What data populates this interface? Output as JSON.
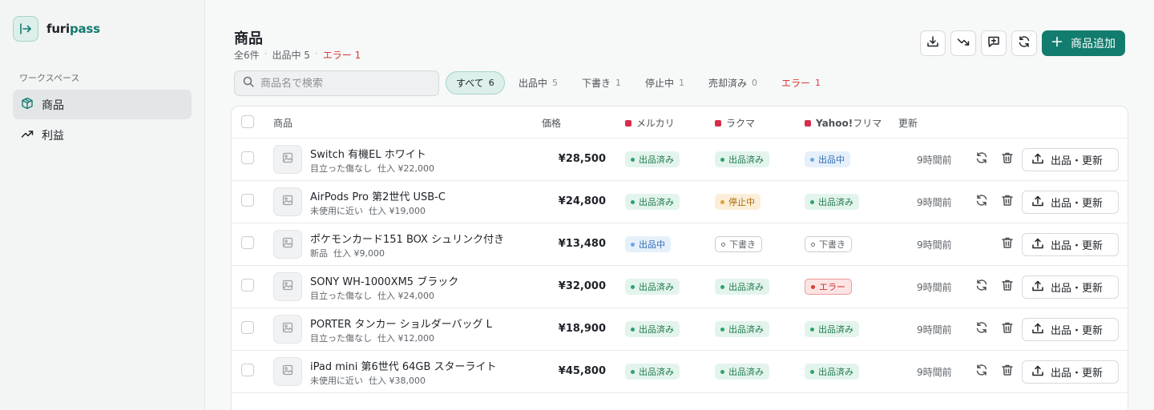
{
  "app": {
    "logo_part1": "furi",
    "logo_part2": "pass",
    "logo_icon": "arrow-into-box-icon",
    "accent_color": "#127c6e"
  },
  "sidebar": {
    "section_label": "ワークスペース",
    "items": [
      {
        "label": "商品",
        "icon": "package-icon",
        "active": true
      },
      {
        "label": "利益",
        "icon": "trending-up-icon",
        "active": false
      }
    ]
  },
  "header": {
    "title": "商品",
    "total": "全6件",
    "listing": "出品中 5",
    "error": "エラー 1",
    "separator": "·",
    "toolbar_icons": [
      "download-icon",
      "trending-down-icon",
      "message-plus-icon",
      "refresh-icon"
    ],
    "add_button_label": "商品追加"
  },
  "search": {
    "placeholder": "商品名で検索",
    "value": ""
  },
  "filters": [
    {
      "label": "すべて",
      "count": "6",
      "active": true
    },
    {
      "label": "出品中",
      "count": "5",
      "active": false
    },
    {
      "label": "下書き",
      "count": "1",
      "active": false
    },
    {
      "label": "停止中",
      "count": "1",
      "active": false
    },
    {
      "label": "売却済み",
      "count": "0",
      "active": false
    },
    {
      "label": "エラー",
      "count": "1",
      "active": false
    }
  ],
  "table": {
    "columns": {
      "product": "商品",
      "price": "価格",
      "mercari": "メルカリ",
      "rakuma": "ラクマ",
      "yahoo_bold": "Yahoo!",
      "yahoo_rest": "フリマ",
      "updated": "更新"
    },
    "platform_marker_color": "#d62d4a",
    "action_label": "出品・更新",
    "rows": [
      {
        "name": "Switch 有機EL ホワイト",
        "condition": "目立った傷なし",
        "cost": "仕入 ¥22,000",
        "price": "¥28,500",
        "mercari": {
          "label": "出品済み",
          "status": "listed"
        },
        "rakuma": {
          "label": "出品済み",
          "status": "listed"
        },
        "yahoo": {
          "label": "出品中",
          "status": "listing"
        },
        "updated": "9時間前",
        "show_refresh": true
      },
      {
        "name": "AirPods Pro 第2世代 USB-C",
        "condition": "未使用に近い",
        "cost": "仕入 ¥19,000",
        "price": "¥24,800",
        "mercari": {
          "label": "出品済み",
          "status": "listed"
        },
        "rakuma": {
          "label": "停止中",
          "status": "stopped"
        },
        "yahoo": {
          "label": "出品済み",
          "status": "listed"
        },
        "updated": "9時間前",
        "show_refresh": true
      },
      {
        "name": "ポケモンカード151 BOX シュリンク付き",
        "condition": "新品",
        "cost": "仕入 ¥9,000",
        "price": "¥13,480",
        "mercari": {
          "label": "出品中",
          "status": "listing"
        },
        "rakuma": {
          "label": "下書き",
          "status": "draft"
        },
        "yahoo": {
          "label": "下書き",
          "status": "draft"
        },
        "updated": "9時間前",
        "show_refresh": false
      },
      {
        "name": "SONY WH-1000XM5 ブラック",
        "condition": "目立った傷なし",
        "cost": "仕入 ¥24,000",
        "price": "¥32,000",
        "mercari": {
          "label": "出品済み",
          "status": "listed"
        },
        "rakuma": {
          "label": "出品済み",
          "status": "listed"
        },
        "yahoo": {
          "label": "エラー",
          "status": "error"
        },
        "updated": "9時間前",
        "show_refresh": true
      },
      {
        "name": "PORTER タンカー ショルダーバッグ L",
        "condition": "目立った傷なし",
        "cost": "仕入 ¥12,000",
        "price": "¥18,900",
        "mercari": {
          "label": "出品済み",
          "status": "listed"
        },
        "rakuma": {
          "label": "出品済み",
          "status": "listed"
        },
        "yahoo": {
          "label": "出品済み",
          "status": "listed"
        },
        "updated": "9時間前",
        "show_refresh": true
      },
      {
        "name": "iPad mini 第6世代 64GB スターライト",
        "condition": "未使用に近い",
        "cost": "仕入 ¥38,000",
        "price": "¥45,800",
        "mercari": {
          "label": "出品済み",
          "status": "listed"
        },
        "rakuma": {
          "label": "出品済み",
          "status": "listed"
        },
        "yahoo": {
          "label": "出品済み",
          "status": "listed"
        },
        "updated": "9時間前",
        "show_refresh": true
      }
    ]
  }
}
